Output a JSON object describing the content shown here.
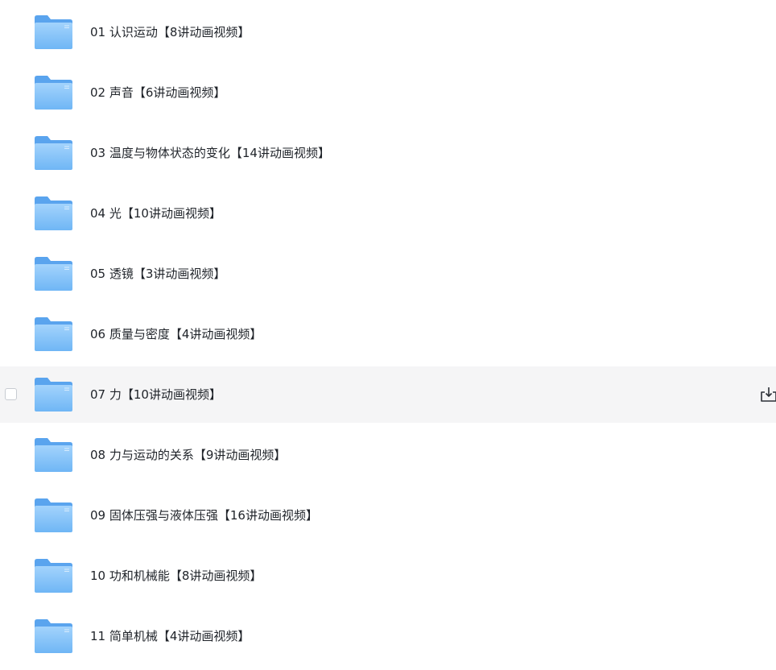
{
  "folders": [
    {
      "label": "01 认识运动【8讲动画视频】"
    },
    {
      "label": "02 声音【6讲动画视频】"
    },
    {
      "label": "03 温度与物体状态的变化【14讲动画视频】"
    },
    {
      "label": "04 光【10讲动画视频】"
    },
    {
      "label": "05 透镜【3讲动画视频】"
    },
    {
      "label": "06 质量与密度【4讲动画视频】"
    },
    {
      "label": "07 力【10讲动画视频】"
    },
    {
      "label": "08 力与运动的关系【9讲动画视频】"
    },
    {
      "label": "09 固体压强与液体压强【16讲动画视频】"
    },
    {
      "label": "10 功和机械能【8讲动画视频】"
    },
    {
      "label": "11 简单机械【4讲动画视频】"
    }
  ],
  "hovered_index": 6,
  "icons": {
    "folder": "folder-icon",
    "download": "download-icon"
  },
  "colors": {
    "folder_back": "#5aa4ee",
    "folder_front_top": "#9fd0fb",
    "folder_front_bottom": "#6db5f5",
    "hover_bg": "#f5f5f6",
    "text": "#1f2329"
  }
}
